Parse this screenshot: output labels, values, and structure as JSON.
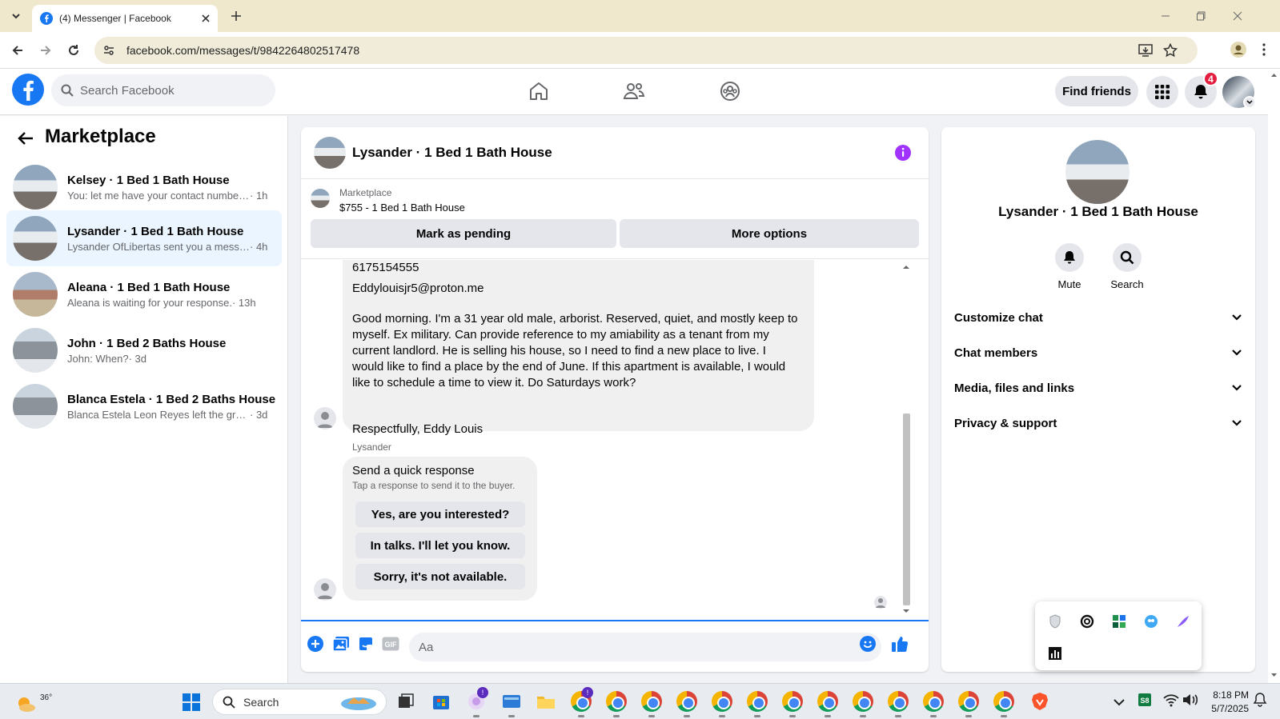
{
  "browser": {
    "tab_title": "(4) Messenger | Facebook",
    "url": "facebook.com/messages/t/9842264802517478"
  },
  "fb_header": {
    "search_placeholder": "Search Facebook",
    "find_friends_label": "Find friends",
    "notification_count": "4"
  },
  "sidebar": {
    "title": "Marketplace",
    "conversations": [
      {
        "name": "Kelsey · 1 Bed 1 Bath House",
        "preview": "You: let me have your contact number...",
        "time": "· 1h"
      },
      {
        "name": "Lysander · 1 Bed 1 Bath House",
        "preview": "Lysander OfLibertas sent you a messa...",
        "time": "· 4h"
      },
      {
        "name": "Aleana · 1 Bed 1 Bath House",
        "preview": "Aleana is waiting for your response.",
        "time": "· 13h"
      },
      {
        "name": "John · 1 Bed 2 Baths House",
        "preview": "John: When?",
        "time": "· 3d"
      },
      {
        "name": "Blanca Estela · 1 Bed 2 Baths House",
        "preview": "Blanca Estela Leon Reyes left the grou...",
        "time": "· 3d"
      }
    ]
  },
  "chat": {
    "title": "Lysander · 1 Bed 1 Bath House",
    "listing_label": "Marketplace",
    "listing_title": "$755 - 1 Bed 1 Bath House",
    "mark_pending_label": "Mark as pending",
    "more_options_label": "More options",
    "msg_phone_partial": "6175154555",
    "msg_email": "Eddylouisjr5@proton.me",
    "msg_body": "Good morning. I'm a 31 year old male, arborist. Reserved, quiet, and mostly keep to myself. Ex military. Can provide reference to my amiability as a tenant from my current landlord. He is selling his house, so I need to find a new place to live. I would like to find a place by the end of June. If this apartment is available, I would like to schedule a time to view it. Do Saturdays work?",
    "msg_sign": "Respectfully, Eddy Louis",
    "sender_label": "Lysander",
    "quick_response_title": "Send a quick response",
    "quick_response_sub": "Tap a response to send it to the buyer.",
    "quick_responses": [
      "Yes, are you interested?",
      "In talks. I'll let you know.",
      "Sorry, it's not available."
    ],
    "composer_placeholder": "Aa"
  },
  "info_panel": {
    "title": "Lysander · 1 Bed 1 Bath House",
    "mute_label": "Mute",
    "search_label": "Search",
    "sections": [
      "Customize chat",
      "Chat members",
      "Media, files and links",
      "Privacy & support"
    ]
  },
  "taskbar": {
    "temperature": "36°",
    "search_placeholder": "Search",
    "time": "8:18 PM",
    "date": "5/7/2025"
  },
  "colors": {
    "fb_blue": "#1877f2",
    "messenger_purple": "#a033ff",
    "active_row": "#ebf5ff"
  }
}
